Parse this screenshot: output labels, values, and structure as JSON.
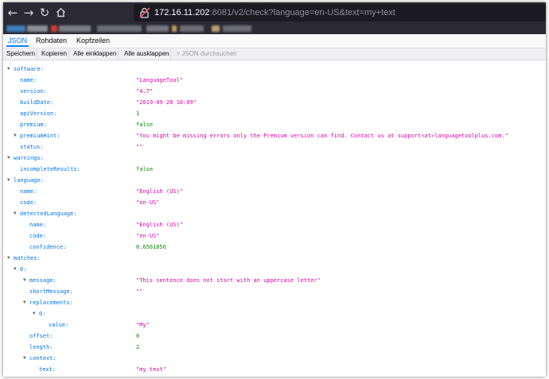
{
  "browser": {
    "url": {
      "host": "172.16.11.202",
      "rest": ":8081/v2/check?language=en-US&text=my+text"
    }
  },
  "tabs": [
    {
      "label": "JSON",
      "active": true
    },
    {
      "label": "Rohdaten",
      "active": false
    },
    {
      "label": "Kopfzeilen",
      "active": false
    }
  ],
  "toolbar": {
    "save": "Speichern",
    "copy": "Kopieren",
    "expand_all": "Alle einklappen",
    "collapse_all": "Alle ausklappen",
    "filter_placeholder": "JSON durchsuchen"
  },
  "rows": [
    {
      "depth": 0,
      "key": "software:",
      "expand": true
    },
    {
      "depth": 1,
      "key": "name:",
      "value": "\"LanguageTool\"",
      "type": "str"
    },
    {
      "depth": 1,
      "key": "version:",
      "value": "\"4.7\"",
      "type": "str"
    },
    {
      "depth": 1,
      "key": "buildDate:",
      "value": "\"2019-09-28 10:09\"",
      "type": "str"
    },
    {
      "depth": 1,
      "key": "apiVersion:",
      "value": "1",
      "type": "num"
    },
    {
      "depth": 1,
      "key": "premium:",
      "value": "false",
      "type": "bool"
    },
    {
      "depth": 1,
      "key": "premiumHint:",
      "value": "\"You might be missing errors only the Premium version can find. Contact us at support<at>languagetoolplus.com.\"",
      "type": "str",
      "expand": true
    },
    {
      "depth": 1,
      "key": "status:",
      "value": "\"\"",
      "type": "str"
    },
    {
      "depth": 0,
      "key": "warnings:",
      "expand": true
    },
    {
      "depth": 1,
      "key": "incompleteResults:",
      "value": "false",
      "type": "bool"
    },
    {
      "depth": 0,
      "key": "language:",
      "expand": true
    },
    {
      "depth": 1,
      "key": "name:",
      "value": "\"English (US)\"",
      "type": "str"
    },
    {
      "depth": 1,
      "key": "code:",
      "value": "\"en-US\"",
      "type": "str"
    },
    {
      "depth": 1,
      "key": "detectedLanguage:",
      "expand": true
    },
    {
      "depth": 2,
      "key": "name:",
      "value": "\"English (US)\"",
      "type": "str"
    },
    {
      "depth": 2,
      "key": "code:",
      "value": "\"en-US\"",
      "type": "str"
    },
    {
      "depth": 2,
      "key": "confidence:",
      "value": "0.6561856",
      "type": "num"
    },
    {
      "depth": 0,
      "key": "matches:",
      "expand": true
    },
    {
      "depth": 1,
      "key": "0:",
      "expand": true
    },
    {
      "depth": 2,
      "key": "message:",
      "value": "\"This sentence does not start with an uppercase letter\"",
      "type": "str",
      "expand": true
    },
    {
      "depth": 2,
      "key": "shortMessage:",
      "value": "\"\"",
      "type": "str"
    },
    {
      "depth": 2,
      "key": "replacements:",
      "expand": true
    },
    {
      "depth": 3,
      "key": "0:",
      "expand": true
    },
    {
      "depth": 4,
      "key": "value:",
      "value": "\"My\"",
      "type": "str"
    },
    {
      "depth": 2,
      "key": "offset:",
      "value": "0",
      "type": "num"
    },
    {
      "depth": 2,
      "key": "length:",
      "value": "2",
      "type": "num"
    },
    {
      "depth": 2,
      "key": "context:",
      "expand": true
    },
    {
      "depth": 3,
      "key": "text:",
      "value": "\"my text\"",
      "type": "str"
    }
  ]
}
